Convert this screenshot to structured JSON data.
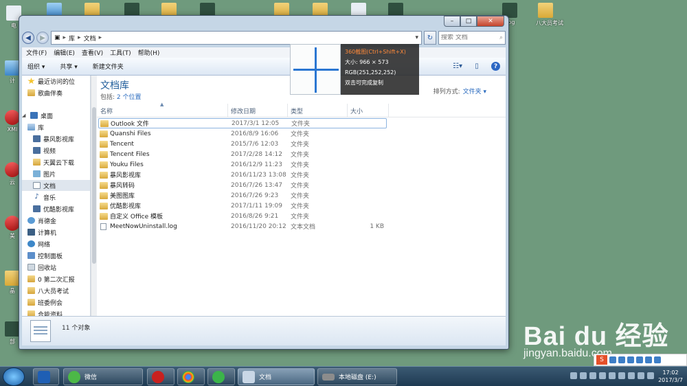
{
  "desktop": {
    "left_labels": [
      "电",
      "计",
      "XMI",
      "云",
      "美",
      "晶",
      "部"
    ],
    "top_labels": [
      "",
      "",
      "",
      "",
      "",
      "",
      "",
      "",
      "",
      ".jpg",
      "八大员考试"
    ]
  },
  "window": {
    "address": {
      "crumbs": [
        "库",
        "文档"
      ]
    },
    "search_placeholder": "搜索 文档",
    "menu": [
      "文件(F)",
      "编辑(E)",
      "查看(V)",
      "工具(T)",
      "帮助(H)"
    ],
    "toolbar": {
      "organize": "组织 ▾",
      "share": "共享 ▾",
      "new_folder": "新建文件夹"
    },
    "nav": [
      {
        "label": "最近访问的位",
        "icon": "star"
      },
      {
        "label": "歌曲伴奏",
        "icon": "folder"
      },
      {
        "label": "桌面",
        "icon": "desktop"
      },
      {
        "label": "库",
        "icon": "lib"
      },
      {
        "label": "暴风影视库",
        "icon": "video"
      },
      {
        "label": "视频",
        "icon": "video"
      },
      {
        "label": "天翼云下载",
        "icon": "folder"
      },
      {
        "label": "图片",
        "icon": "image"
      },
      {
        "label": "文档",
        "icon": "doc"
      },
      {
        "label": "音乐",
        "icon": "music"
      },
      {
        "label": "优酷影视库",
        "icon": "video"
      },
      {
        "label": "肖德金",
        "icon": "user"
      },
      {
        "label": "计算机",
        "icon": "computer"
      },
      {
        "label": "网络",
        "icon": "net"
      },
      {
        "label": "控制面板",
        "icon": "panel"
      },
      {
        "label": "回收站",
        "icon": "bin"
      },
      {
        "label": "0 第二次汇报",
        "icon": "folder"
      },
      {
        "label": "八大员考试",
        "icon": "folder"
      },
      {
        "label": "班委例会",
        "icon": "folder"
      },
      {
        "label": "合能资料",
        "icon": "folder"
      }
    ],
    "library": {
      "title": "文档库",
      "includes_prefix": "包括:",
      "includes_link": "2 个位置",
      "arrange_label": "排列方式:",
      "arrange_value": "文件夹 ▾"
    },
    "columns": [
      "名称",
      "修改日期",
      "类型",
      "大小"
    ],
    "files": [
      {
        "name": "Outlook 文件",
        "date": "2017/3/1 12:05",
        "type": "文件夹",
        "size": "",
        "kind": "folder"
      },
      {
        "name": "Quanshi Files",
        "date": "2016/8/9 16:06",
        "type": "文件夹",
        "size": "",
        "kind": "folder"
      },
      {
        "name": "Tencent",
        "date": "2015/7/6 12:03",
        "type": "文件夹",
        "size": "",
        "kind": "folder"
      },
      {
        "name": "Tencent Files",
        "date": "2017/2/28 14:12",
        "type": "文件夹",
        "size": "",
        "kind": "folder"
      },
      {
        "name": "Youku Files",
        "date": "2016/12/9 11:23",
        "type": "文件夹",
        "size": "",
        "kind": "folder"
      },
      {
        "name": "暴风影视库",
        "date": "2016/11/23 13:08",
        "type": "文件夹",
        "size": "",
        "kind": "folder"
      },
      {
        "name": "暴风转码",
        "date": "2016/7/26 13:47",
        "type": "文件夹",
        "size": "",
        "kind": "folder"
      },
      {
        "name": "美图图库",
        "date": "2016/7/26 9:23",
        "type": "文件夹",
        "size": "",
        "kind": "folder"
      },
      {
        "name": "优酷影视库",
        "date": "2017/1/11 19:09",
        "type": "文件夹",
        "size": "",
        "kind": "folder"
      },
      {
        "name": "自定义 Office 模板",
        "date": "2016/8/26 9:21",
        "type": "文件夹",
        "size": "",
        "kind": "folder"
      },
      {
        "name": "MeetNowUninstall.log",
        "date": "2016/11/20 20:12",
        "type": "文本文档",
        "size": "1 KB",
        "kind": "file"
      }
    ],
    "status_count": "11 个对象"
  },
  "snip_overlay": {
    "title": "360截图(Ctrl+Shift+X)",
    "size": "大小: 966 × 573",
    "rgb": "RGB(251,252,252)",
    "hint": "双击可完成复制"
  },
  "taskbar": {
    "wechat_label": "微信",
    "explorer_label": "文档",
    "disk_label": "本地磁盘 (E:)",
    "time": "17:02",
    "date": "2017/3/7"
  },
  "watermark": {
    "brand": "Bai du 经验",
    "url": "jingyan.baidu.com"
  },
  "colors": {
    "accent": "#1f5c9a",
    "link": "#2a6bbf",
    "desktop": "#6f9a7d",
    "overlay_hot": "#ff8a3a"
  }
}
